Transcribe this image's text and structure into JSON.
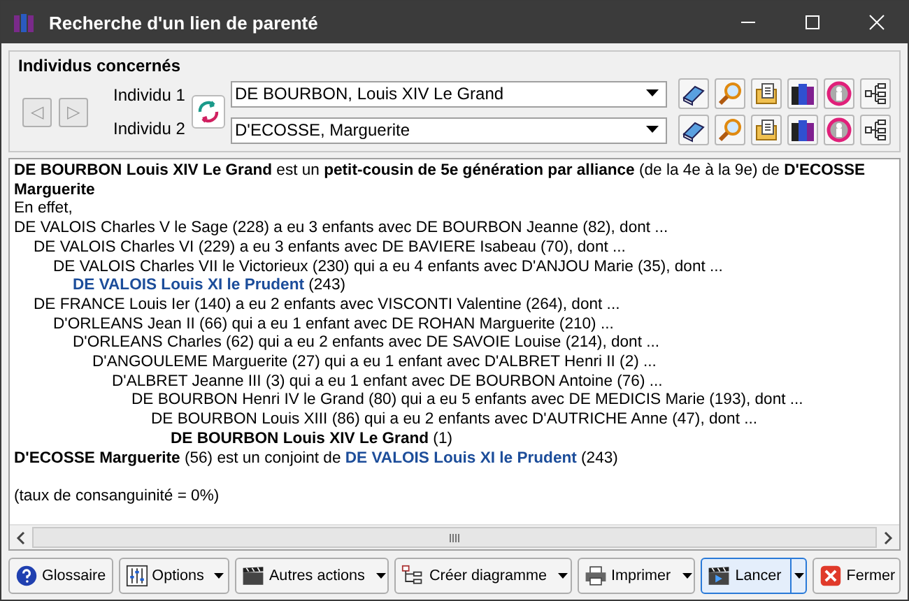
{
  "window": {
    "title": "Recherche d'un lien de parenté"
  },
  "individuals": {
    "title": "Individus concernés",
    "nav": [
      {
        "label": "◁",
        "disabled": true
      },
      {
        "label": "▷",
        "disabled": true
      }
    ],
    "rows": [
      {
        "label": "Individu 1",
        "value": "DE BOURBON, Louis XIV Le Grand"
      },
      {
        "label": "Individu 2",
        "value": "D'ECOSSE, Marguerite"
      }
    ]
  },
  "result": {
    "summary": [
      {
        "kind": "bold",
        "text": "DE BOURBON Louis XIV Le Grand"
      },
      {
        "kind": "plain",
        "text": " est un "
      },
      {
        "kind": "bold",
        "text": "petit-cousin de 5e génération par alliance"
      },
      {
        "kind": "plain",
        "text": " (de la 4e à la 9e) de "
      },
      {
        "kind": "bold",
        "text": "D'ECOSSE Marguerite"
      }
    ],
    "intro": "En effet,",
    "tree": [
      {
        "parts": [
          {
            "kind": "plain",
            "text": "DE VALOIS Charles V le Sage (228) a eu 3 enfants avec DE BOURBON Jeanne (82), dont ..."
          }
        ],
        "children": [
          {
            "parts": [
              {
                "kind": "plain",
                "text": "DE VALOIS Charles VI (229) a eu 3 enfants avec DE BAVIERE Isabeau (70), dont ..."
              }
            ],
            "children": [
              {
                "parts": [
                  {
                    "kind": "plain",
                    "text": "DE VALOIS Charles VII le Victorieux (230) qui a eu 4 enfants avec D'ANJOU Marie (35), dont ..."
                  }
                ],
                "children": [
                  {
                    "parts": [
                      {
                        "kind": "link",
                        "text": "DE VALOIS Louis XI le Prudent"
                      },
                      {
                        "kind": "plain",
                        "text": " (243)"
                      }
                    ]
                  }
                ]
              }
            ]
          },
          {
            "parts": [
              {
                "kind": "plain",
                "text": "DE FRANCE Louis Ier (140) a eu 2 enfants avec VISCONTI Valentine (264), dont ..."
              }
            ],
            "children": [
              {
                "parts": [
                  {
                    "kind": "plain",
                    "text": "D'ORLEANS Jean II (66) qui a eu 1 enfant avec DE ROHAN Marguerite (210) ..."
                  }
                ],
                "children": [
                  {
                    "parts": [
                      {
                        "kind": "plain",
                        "text": "D'ORLEANS Charles (62) qui a eu 2 enfants avec DE SAVOIE Louise (214), dont ..."
                      }
                    ],
                    "children": [
                      {
                        "parts": [
                          {
                            "kind": "plain",
                            "text": "D'ANGOULEME Marguerite (27) qui a eu 1 enfant avec D'ALBRET Henri II (2) ..."
                          }
                        ],
                        "children": [
                          {
                            "parts": [
                              {
                                "kind": "plain",
                                "text": "D'ALBRET Jeanne III (3) qui a eu 1 enfant avec DE BOURBON Antoine (76) ..."
                              }
                            ],
                            "children": [
                              {
                                "parts": [
                                  {
                                    "kind": "plain",
                                    "text": "DE BOURBON Henri IV le Grand (80) qui a eu 5 enfants avec DE MEDICIS Marie (193), dont ..."
                                  }
                                ],
                                "children": [
                                  {
                                    "parts": [
                                      {
                                        "kind": "plain",
                                        "text": "DE BOURBON Louis XIII (86) qui a eu 2 enfants avec D'AUTRICHE Anne (47), dont ..."
                                      }
                                    ],
                                    "children": [
                                      {
                                        "parts": [
                                          {
                                            "kind": "bold",
                                            "text": "DE BOURBON Louis XIV Le Grand"
                                          },
                                          {
                                            "kind": "plain",
                                            "text": " (1)"
                                          }
                                        ]
                                      }
                                    ]
                                  }
                                ]
                              }
                            ]
                          }
                        ]
                      }
                    ]
                  }
                ]
              }
            ]
          }
        ]
      }
    ],
    "conclusion": [
      {
        "kind": "bold",
        "text": "D'ECOSSE Marguerite"
      },
      {
        "kind": "plain",
        "text": " (56) est un conjoint de "
      },
      {
        "kind": "link",
        "text": "DE VALOIS Louis XI le Prudent"
      },
      {
        "kind": "plain",
        "text": " (243)"
      }
    ],
    "rate": "(taux de consanguinité = 0%)"
  },
  "buttons": [
    {
      "kind": "help",
      "label": "Glossaire",
      "menu": false,
      "default": false
    },
    {
      "kind": "options",
      "label": "Options",
      "menu": true,
      "default": false
    },
    {
      "kind": "clap",
      "label": "Autres actions",
      "menu": true,
      "default": false
    },
    {
      "kind": "diagram",
      "label": "Créer diagramme",
      "menu": true,
      "default": false
    },
    {
      "kind": "print",
      "label": "Imprimer",
      "menu": true,
      "default": false
    },
    {
      "kind": "run",
      "label": "Lancer",
      "menu": true,
      "default": true
    },
    {
      "kind": "close",
      "label": "Fermer",
      "menu": false,
      "default": false
    }
  ]
}
